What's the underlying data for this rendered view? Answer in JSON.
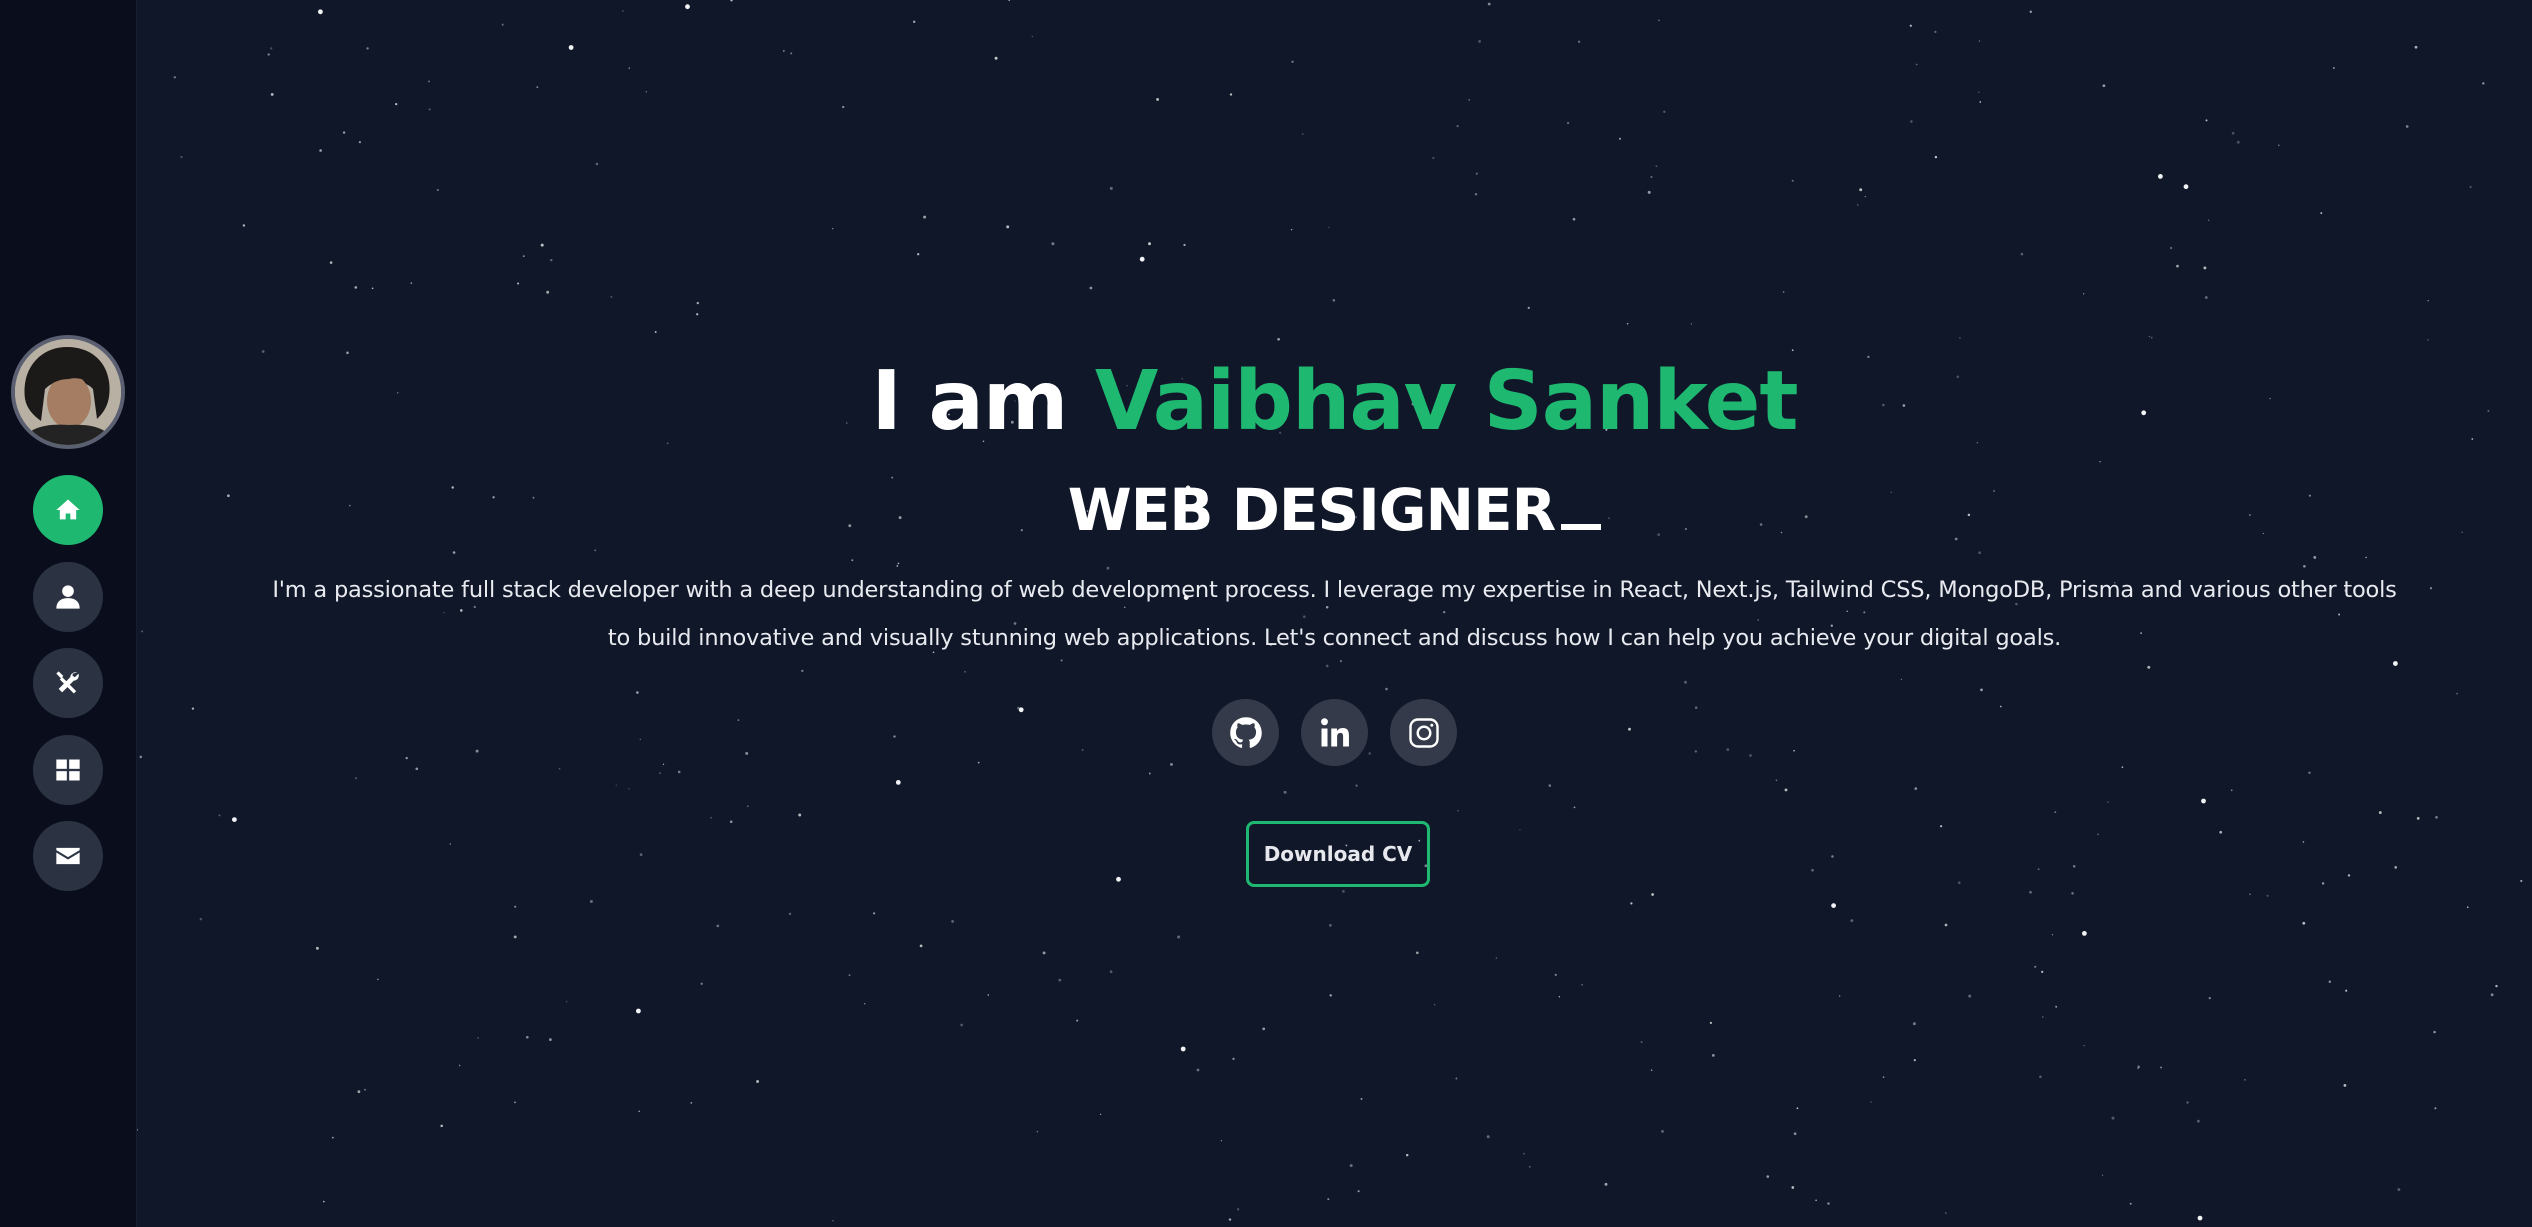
{
  "colors": {
    "background": "#101729",
    "sidebar": "#0a0e1c",
    "accent": "#1eb871",
    "nav_button": "#2b3242",
    "social_button": "#343a49"
  },
  "sidebar": {
    "avatar_alt": "profile photo",
    "items": [
      {
        "name": "home",
        "icon": "home-icon",
        "active": true
      },
      {
        "name": "about",
        "icon": "user-icon",
        "active": false
      },
      {
        "name": "skills",
        "icon": "tools-icon",
        "active": false
      },
      {
        "name": "projects",
        "icon": "grid-icon",
        "active": false
      },
      {
        "name": "contact",
        "icon": "envelope-icon",
        "active": false
      }
    ]
  },
  "hero": {
    "greeting": "I am",
    "name": "Vaibhav Sanket",
    "role": "WEB DESIGNER",
    "intro": "I'm a passionate full stack developer with a deep understanding of web development process. I leverage my expertise in React, Next.js, Tailwind CSS, MongoDB, Prisma and various other tools to build innovative and visually stunning web applications. Let's connect and discuss how I can help you achieve your digital goals.",
    "socials": [
      {
        "name": "github",
        "icon": "github-icon"
      },
      {
        "name": "linkedin",
        "icon": "linkedin-icon"
      },
      {
        "name": "instagram",
        "icon": "instagram-icon"
      }
    ],
    "cv_button": "Download CV"
  }
}
